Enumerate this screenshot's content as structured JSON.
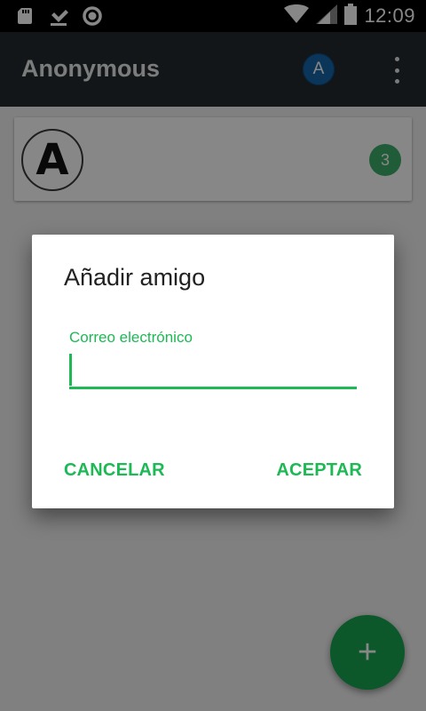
{
  "status_bar": {
    "time": "12:09",
    "icons": [
      "sd-card-icon",
      "download-done-icon",
      "sync-ring-icon",
      "wifi-icon",
      "cell-signal-icon",
      "battery-icon"
    ]
  },
  "app_bar": {
    "title": "Anonymous",
    "avatar_letter": "A",
    "avatar_color": "#1766a8",
    "background_color": "#232a2e"
  },
  "friends": [
    {
      "avatar_letter": "A",
      "unread_count": "3"
    }
  ],
  "fab": {
    "icon": "plus-icon",
    "glyph": "+",
    "color": "#18a651"
  },
  "dialog": {
    "title": "Añadir amigo",
    "field_label": "Correo electrónico",
    "field_value": "",
    "cancel_label": "CANCELAR",
    "accept_label": "ACEPTAR",
    "accent_color": "#1db954"
  }
}
